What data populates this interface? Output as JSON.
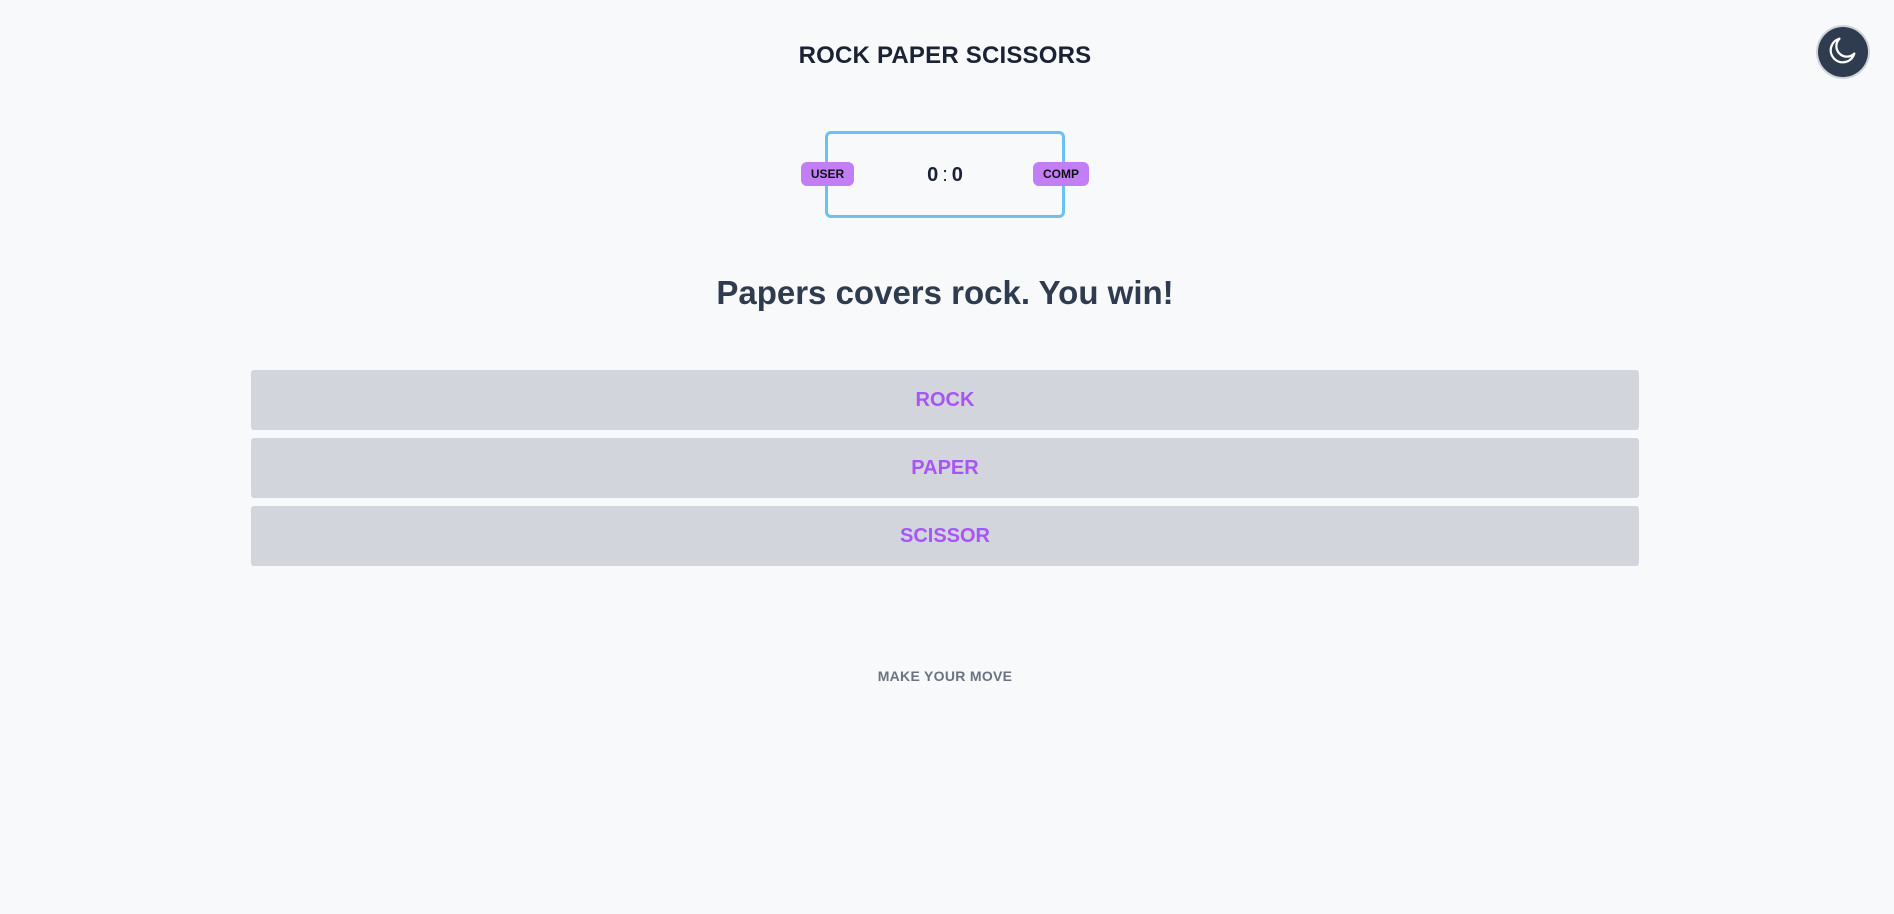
{
  "header": {
    "title": "ROCK PAPER SCISSORS",
    "theme_toggle_icon": "moon-icon"
  },
  "scoreboard": {
    "user_label": "USER",
    "comp_label": "COMP",
    "user_score": "0",
    "separator": ":",
    "comp_score": "0"
  },
  "result": {
    "message": "Papers covers rock. You win!"
  },
  "choices": [
    {
      "label": "ROCK"
    },
    {
      "label": "PAPER"
    },
    {
      "label": "SCISSOR"
    }
  ],
  "footer": {
    "hint": "MAKE YOUR MOVE"
  },
  "colors": {
    "background": "#f8f9fb",
    "accent": "#a855f7",
    "badge": "#c27ef5",
    "scoreboard_border": "#6cc1f0",
    "button_bg": "#d2d5dc"
  }
}
